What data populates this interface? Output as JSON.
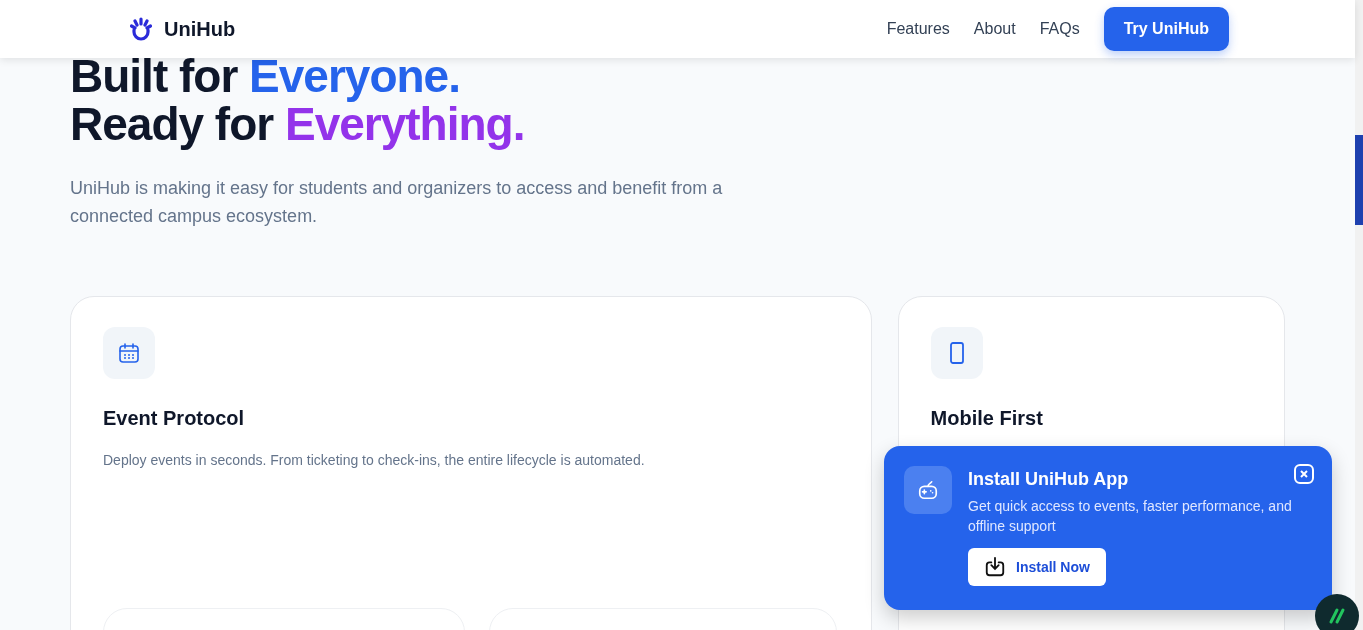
{
  "header": {
    "brand": "UniHub",
    "nav": [
      "Features",
      "About",
      "FAQs"
    ],
    "cta": "Try UniHub"
  },
  "hero": {
    "line1": "Built for ",
    "accent1": "Everyone.",
    "line2": "Ready for ",
    "accent2": "Everything.",
    "description": "UniHub is making it easy for students and organizers to access and benefit from a connected campus ecosystem."
  },
  "features": [
    {
      "kind": "calendar",
      "title": "Event Protocol",
      "description": "Deploy events in seconds. From ticketing to check-ins, the entire lifecycle is automated."
    },
    {
      "kind": "phone",
      "title": "Mobile First"
    }
  ],
  "install_prompt": {
    "title": "Install UniHub App",
    "description": "Get quick access to events, faster performance, and offline support",
    "button": "Install Now"
  }
}
